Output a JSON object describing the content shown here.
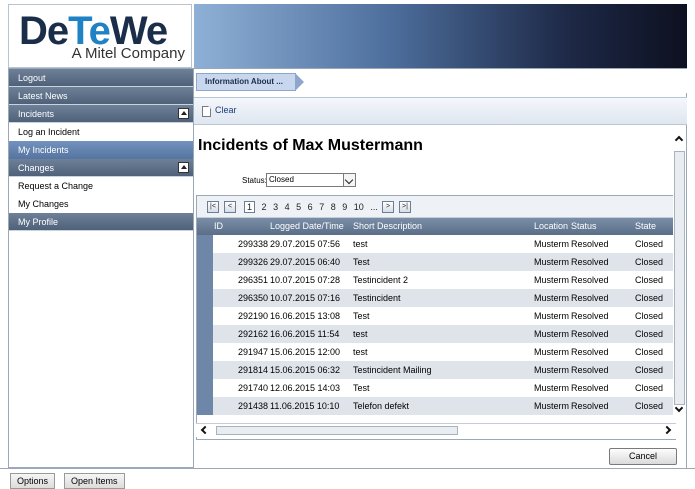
{
  "brand": {
    "name_part1": "De",
    "name_part2": "Te",
    "name_part3": "We",
    "tagline": "A Mitel Company"
  },
  "sidebar": {
    "logout": "Logout",
    "latest_news": "Latest News",
    "incidents": "Incidents",
    "incident_items": [
      "Log an Incident",
      "My Incidents"
    ],
    "changes": "Changes",
    "change_items": [
      "Request a Change",
      "My Changes"
    ],
    "my_profile": "My Profile"
  },
  "breadcrumb": "Information About ...",
  "toolbar": {
    "clear": "Clear"
  },
  "page_title": "Incidents of Max Mustermann",
  "filter": {
    "label": "Status:",
    "value": "Closed"
  },
  "pager": {
    "current": "1",
    "pages": [
      "2",
      "3",
      "4",
      "5",
      "6",
      "7",
      "8",
      "9",
      "10",
      "..."
    ]
  },
  "grid": {
    "columns": [
      "ID",
      "Logged Date/Time",
      "Short Description",
      "Location",
      "Status",
      "State"
    ],
    "rows": [
      [
        "299338",
        "29.07.2015 07:56",
        "test",
        "Musterm",
        "Resolved",
        "Closed"
      ],
      [
        "299326",
        "29.07.2015 06:40",
        "Test",
        "Musterm",
        "Resolved",
        "Closed"
      ],
      [
        "296351",
        "10.07.2015 07:28",
        "Testincident 2",
        "Musterm",
        "Resolved",
        "Closed"
      ],
      [
        "296350",
        "10.07.2015 07:16",
        "Testincident",
        "Musterm",
        "Resolved",
        "Closed"
      ],
      [
        "292190",
        "16.06.2015 13:08",
        "Test",
        "Musterm",
        "Resolved",
        "Closed"
      ],
      [
        "292162",
        "16.06.2015 11:54",
        "test",
        "Musterm",
        "Resolved",
        "Closed"
      ],
      [
        "291947",
        "15.06.2015 12:00",
        "test",
        "Musterm",
        "Resolved",
        "Closed"
      ],
      [
        "291814",
        "15.06.2015 06:32",
        "Testincident Mailing",
        "Musterm",
        "Resolved",
        "Closed"
      ],
      [
        "291740",
        "12.06.2015 14:03",
        "Test",
        "Musterm",
        "Resolved",
        "Closed"
      ],
      [
        "291438",
        "11.06.2015 10:10",
        "Telefon defekt",
        "Musterm",
        "Resolved",
        "Closed"
      ]
    ]
  },
  "actions": {
    "cancel": "Cancel"
  },
  "bottom_tabs": [
    "Options",
    "Open Items"
  ]
}
